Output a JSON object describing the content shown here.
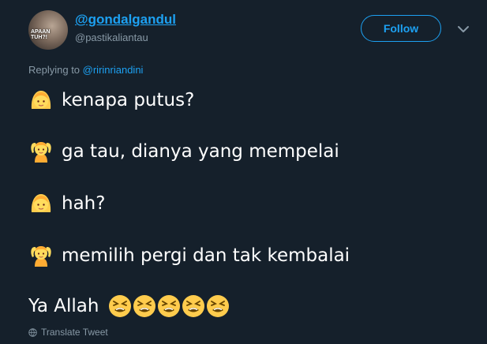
{
  "user": {
    "display_name": "@gondalgandul",
    "handle": "@pastikaliantau",
    "avatar_text": "APAAN TUH?!"
  },
  "follow_button": {
    "label": "Follow"
  },
  "reply": {
    "prefix": "Replying to ",
    "mention": "@ririnriandini"
  },
  "tweet": {
    "lines": [
      {
        "emoji": "person-blond-hair-emoji",
        "text": "kenapa putus?"
      },
      {
        "emoji": "person-gesturing-ok-emoji",
        "text": "ga tau, dianya yang mempelai"
      },
      {
        "emoji": "person-blond-hair-emoji",
        "text": "hah?"
      },
      {
        "emoji": "person-gesturing-ok-emoji",
        "text": "memilih pergi dan tak kembalai"
      }
    ],
    "last_line": {
      "text": "Ya Allah",
      "emoji": "tired-face-emoji",
      "emoji_count": 5
    }
  },
  "translate": {
    "label": "Translate Tweet",
    "icon": "globe-icon"
  },
  "colors": {
    "background": "#15202b",
    "accent": "#1da1f2",
    "secondary_text": "#8899a6",
    "text": "#ffffff",
    "emoji_yellow": "#ffcc4d"
  }
}
